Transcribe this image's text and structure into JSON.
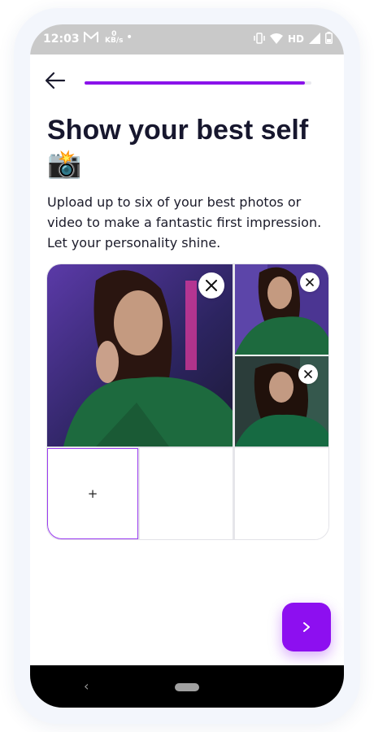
{
  "status_bar": {
    "time": "12:03",
    "kb_label": "0\nKB/s",
    "network": "HD",
    "icons": [
      "gmail-icon",
      "vibrate-icon",
      "wifi-icon",
      "signal-icon",
      "battery-icon"
    ]
  },
  "header": {
    "back_icon": "arrow-left-icon",
    "progress": 0.97,
    "progress_color": "#8a12ea"
  },
  "title": {
    "text": "Show your best self",
    "emoji": "📸"
  },
  "description": "Upload up to six of your best photos or video to make a fantastic first impression. Let your personality shine.",
  "photos": [
    {
      "slot": 1,
      "filled": true,
      "remove_label": "×"
    },
    {
      "slot": 2,
      "filled": true,
      "remove_label": "×"
    },
    {
      "slot": 3,
      "filled": true,
      "remove_label": "×"
    },
    {
      "slot": 4,
      "filled": false,
      "add_label": "+"
    },
    {
      "slot": 5,
      "filled": false
    },
    {
      "slot": 6,
      "filled": false
    }
  ],
  "next_button": {
    "icon": "chevron-right-icon",
    "label": "›",
    "color": "#8d0ff0"
  },
  "nav_bar": {
    "back_label": "‹"
  }
}
